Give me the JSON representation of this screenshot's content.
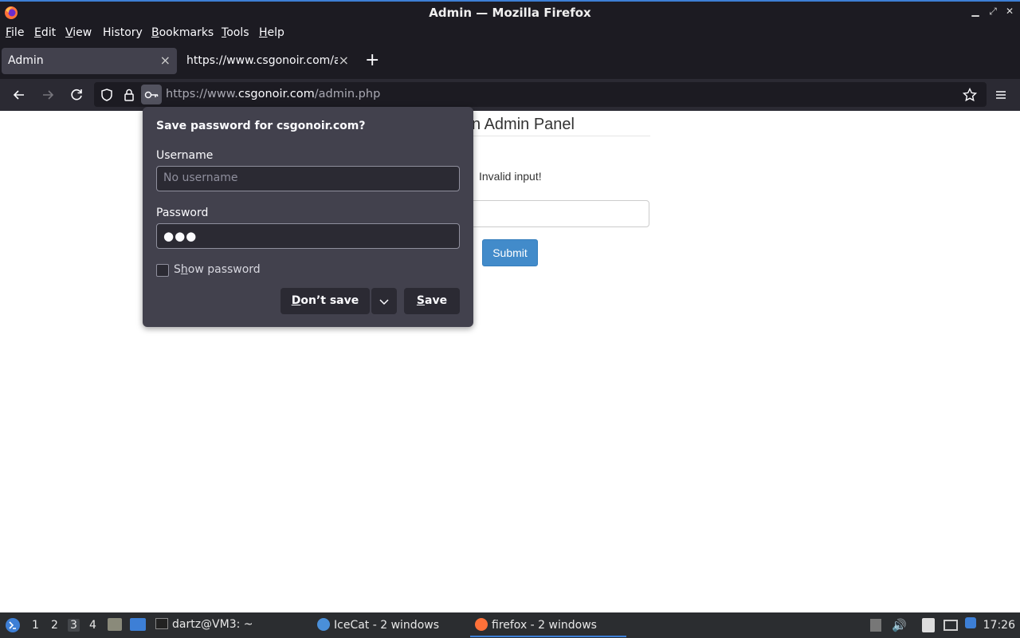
{
  "window": {
    "title": "Admin — Mozilla Firefox"
  },
  "menubar": [
    {
      "label": "File",
      "u": "F",
      "rest": "ile"
    },
    {
      "label": "Edit",
      "u": "E",
      "rest": "dit"
    },
    {
      "label": "View",
      "u": "V",
      "rest": "iew"
    },
    {
      "label": "History",
      "u": "",
      "rest": "History"
    },
    {
      "label": "Bookmarks",
      "u": "B",
      "rest": "ookmarks"
    },
    {
      "label": "Tools",
      "u": "T",
      "rest": "ools"
    },
    {
      "label": "Help",
      "u": "H",
      "rest": "elp"
    }
  ],
  "tabs": [
    {
      "label": "Admin",
      "active": true
    },
    {
      "label": "https://www.csgonoir.com/admin",
      "active": false
    }
  ],
  "urlbar": {
    "prefix": "https://www.",
    "host": "csgonoir.com",
    "path": "/admin.php"
  },
  "page": {
    "panel_title": "n Admin Panel",
    "error": "Invalid input!",
    "submit_label": "Submit"
  },
  "popup": {
    "title": "Save password for csgonoir.com?",
    "username_label": "Username",
    "username_placeholder": "No username",
    "password_label": "Password",
    "password_value": "●●●",
    "show_password_label_u": "h",
    "show_password_label_pre": "S",
    "show_password_label_post": "ow password",
    "dont_save_u": "D",
    "dont_save_rest": "on’t save",
    "save_u": "S",
    "save_rest": "ave"
  },
  "taskbar": {
    "workspaces": [
      "1",
      "2",
      "3",
      "4"
    ],
    "current_workspace": "3",
    "items": [
      {
        "label": "dartz@VM3: ~",
        "icon": "terminal-icon"
      },
      {
        "label": "IceCat - 2 windows",
        "icon": "icecat-icon"
      },
      {
        "label": "firefox - 2 windows",
        "icon": "firefox-icon",
        "active": true
      }
    ],
    "clock": "17:26"
  },
  "colors": {
    "accent": "#3d7fd6",
    "submit": "#428bca",
    "popup_bg": "#42414d",
    "chrome_dark": "#1c1b22"
  }
}
